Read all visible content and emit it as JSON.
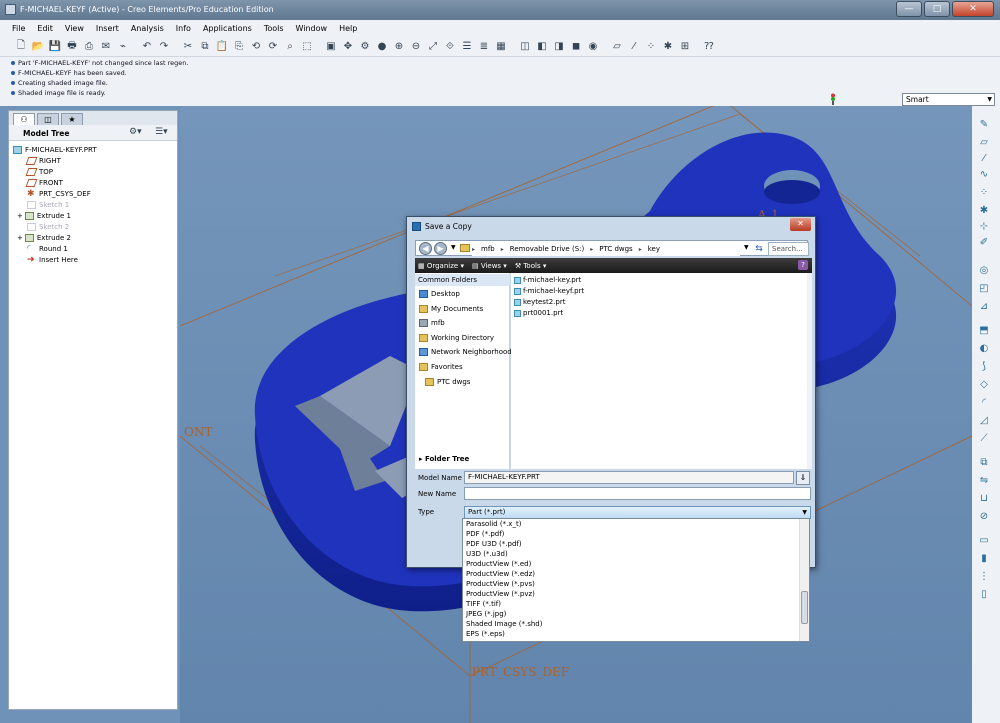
{
  "window": {
    "title": "F-MICHAEL-KEYF (Active) - Creo Elements/Pro Education Edition",
    "min": "—",
    "max": "□",
    "close": "✕"
  },
  "menu": [
    "File",
    "Edit",
    "View",
    "Insert",
    "Analysis",
    "Info",
    "Applications",
    "Tools",
    "Window",
    "Help"
  ],
  "messages": [
    "Part 'F-MICHAEL-KEYF' not changed since last regen.",
    "F-MICHAEL-KEYF has been saved.",
    "Creating shaded image file.",
    "Shaded image file is ready."
  ],
  "filter": {
    "value": "Smart"
  },
  "model_tree": {
    "title": "Model Tree",
    "nodes": [
      {
        "label": "F-MICHAEL-KEYF.PRT",
        "icon": "part-icon"
      },
      {
        "label": "RIGHT",
        "icon": "datum-plane-icon"
      },
      {
        "label": "TOP",
        "icon": "datum-plane-icon"
      },
      {
        "label": "FRONT",
        "icon": "datum-plane-icon"
      },
      {
        "label": "PRT_CSYS_DEF",
        "icon": "csys-icon"
      },
      {
        "label": "Sketch 1",
        "icon": "sketch-icon"
      },
      {
        "label": "Extrude 1",
        "icon": "extrude-icon"
      },
      {
        "label": "Sketch 2",
        "icon": "sketch-icon"
      },
      {
        "label": "Extrude 2",
        "icon": "extrude-icon"
      },
      {
        "label": "Round 1",
        "icon": "round-icon"
      },
      {
        "label": "Insert Here",
        "icon": "insert-arrow-icon"
      }
    ]
  },
  "viewport": {
    "datum_front": "ONT",
    "datum_csys": "PRT_CSYS_DEF",
    "datum_a1": "A_1"
  },
  "dialog": {
    "title": "Save a Copy",
    "path": [
      "mfb",
      "Removable Drive (S:)",
      "PTC dwgs",
      "key"
    ],
    "search_placeholder": "Search...",
    "commands": {
      "organize": "Organize",
      "views": "Views",
      "tools": "Tools"
    },
    "common_folders_label": "Common Folders",
    "folders": [
      "Desktop",
      "My Documents",
      "mfb",
      "Working Directory",
      "Network Neighborhood",
      "Favorites",
      "PTC dwgs"
    ],
    "folder_tree_label": "Folder Tree",
    "files": [
      "f-michael-key.prt",
      "f-michael-keyf.prt",
      "keytest2.prt",
      "prt0001.prt"
    ],
    "model_name_label": "Model Name",
    "model_name_value": "F-MICHAEL-KEYF.PRT",
    "new_name_label": "New Name",
    "new_name_value": "",
    "type_label": "Type",
    "type_value": "Part (*.prt)",
    "type_options": [
      "Parasolid (*.x_t)",
      "PDF (*.pdf)",
      "PDF U3D (*.pdf)",
      "U3D (*.u3d)",
      "ProductView (*.ed)",
      "ProductView (*.edz)",
      "ProductView (*.pvs)",
      "ProductView (*.pvz)",
      "TIFF (*.tif)",
      "JPEG (*.jpg)",
      "Shaded Image (*.shd)",
      "EPS  (*.eps)"
    ]
  },
  "colors": {
    "model_blue": "#1e32b4",
    "background_top": "#6f93b8",
    "background_bottom": "#5d7fa6",
    "datum_orange": "#a8622c"
  }
}
